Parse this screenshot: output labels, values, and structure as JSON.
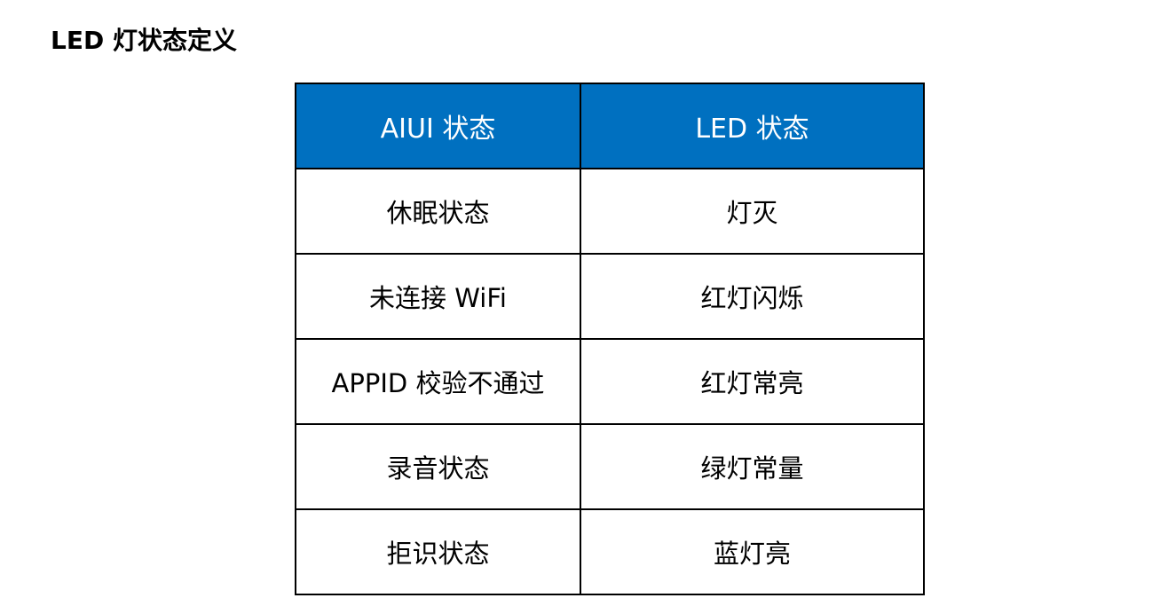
{
  "page": {
    "title": "LED 灯状态定义"
  },
  "table": {
    "header_bg": "#0070C0",
    "headers": [
      "AIUI 状态",
      "LED 状态"
    ],
    "rows": [
      [
        "休眠状态",
        "灯灭"
      ],
      [
        "未连接 WiFi",
        "红灯闪烁"
      ],
      [
        "APPID 校验不通过",
        "红灯常亮"
      ],
      [
        "录音状态",
        "绿灯常量"
      ],
      [
        "拒识状态",
        "蓝灯亮"
      ]
    ]
  }
}
